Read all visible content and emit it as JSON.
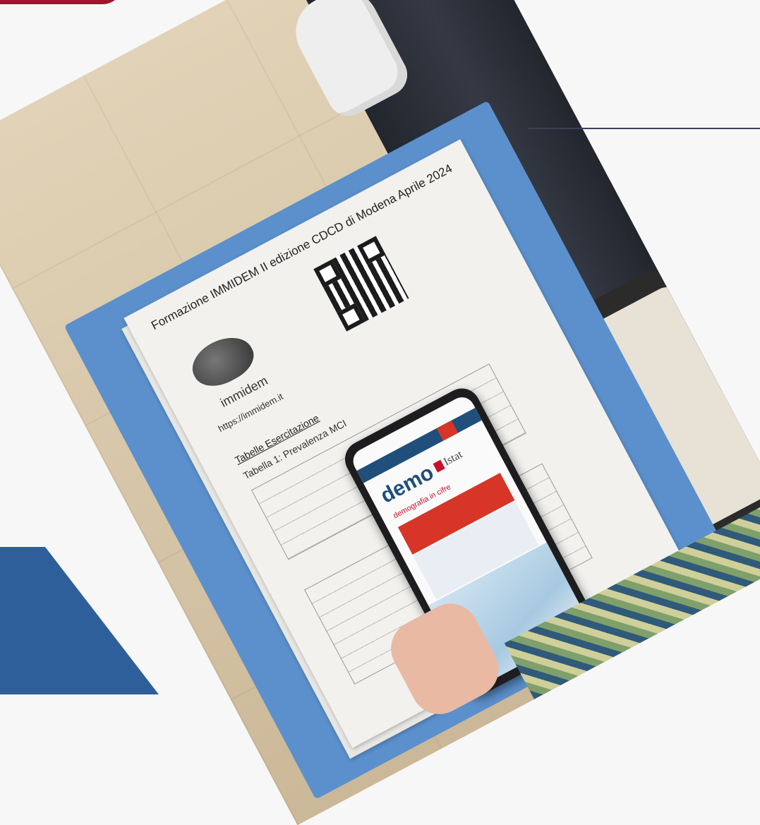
{
  "colors": {
    "background": "#f7f7f7",
    "accent_red": "#a4122b",
    "accent_blue": "#2e5f9a",
    "line": "#3a4156"
  },
  "document": {
    "title": "Formazione IMMIDEM II edizione CDCD di Modena Aprile 2024",
    "brand": "immidem",
    "website": "https://immidem.it",
    "section_heading": "Tabelle Esercitazione",
    "table_caption": "Tabella 1: Prevalenza MCI"
  },
  "phone": {
    "app_title": "demo",
    "app_brand": "Istat",
    "subtitle": "demografia in cifre"
  }
}
